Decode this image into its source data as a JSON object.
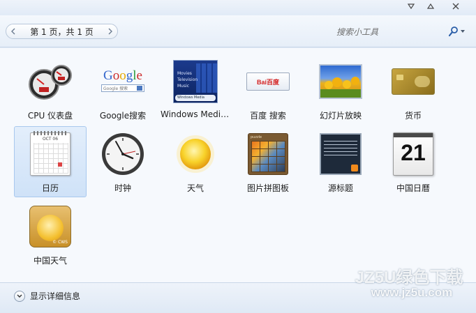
{
  "window": {
    "controls": {
      "minimize_icon": "▽",
      "maximize_icon": "△",
      "close_icon": "✕"
    }
  },
  "toolbar": {
    "page_indicator": "第 1 页，共 1 页",
    "search_placeholder": "搜索小工具"
  },
  "gadgets": [
    {
      "label": "CPU 仪表盘",
      "icon": "cpu-meter-icon"
    },
    {
      "label": "Google搜索",
      "icon": "google-search-icon",
      "logo_text": "Google",
      "search_hint": "Google 搜索"
    },
    {
      "label": "Windows Media...",
      "icon": "windows-media-center-icon",
      "menu": [
        "Movies",
        "Television",
        "Music"
      ],
      "caption": "Windows Media Center"
    },
    {
      "label": "百度 搜索",
      "icon": "baidu-search-icon",
      "logo_text": "Bai百度"
    },
    {
      "label": "幻灯片放映",
      "icon": "slideshow-icon"
    },
    {
      "label": "货币",
      "icon": "currency-icon"
    },
    {
      "label": "日历",
      "icon": "calendar-icon",
      "selected": true,
      "month": "OCT 06",
      "weekdays": [
        "S",
        "M",
        "T",
        "W",
        "T",
        "F",
        "S"
      ]
    },
    {
      "label": "时钟",
      "icon": "clock-icon"
    },
    {
      "label": "天气",
      "icon": "weather-sun-icon"
    },
    {
      "label": "图片拼图板",
      "icon": "picture-puzzle-icon",
      "title": "puzzle"
    },
    {
      "label": "源标题",
      "icon": "feed-headlines-icon"
    },
    {
      "label": "中国日曆",
      "icon": "china-calendar-icon",
      "day": "21"
    },
    {
      "label": "中国天气",
      "icon": "china-weather-icon",
      "badge": "© CWS"
    }
  ],
  "footer": {
    "details_label": "显示详细信息"
  },
  "watermark": {
    "line1": "JZ5U绿色下载",
    "line2": "www.jz5u.com"
  },
  "colors": {
    "accent": "#2a6fd6",
    "selected_bg": "#d5e6f9",
    "content_bg": "#f6f9fd"
  }
}
